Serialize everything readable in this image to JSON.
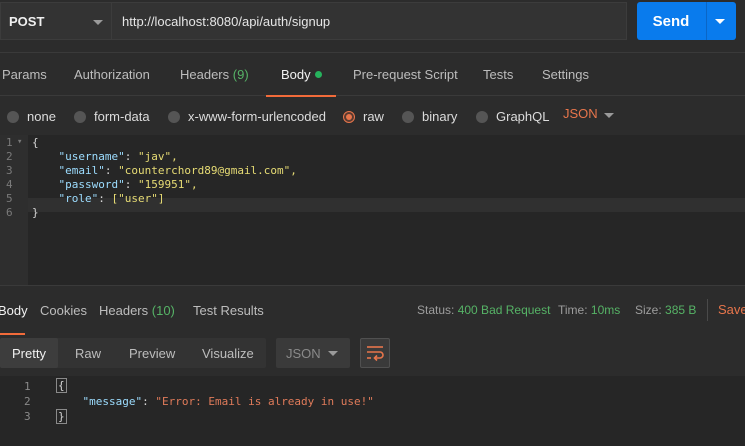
{
  "request": {
    "method": "POST",
    "url": "http://localhost:8080/api/auth/signup",
    "send_label": "Send"
  },
  "request_tabs": {
    "params": "Params",
    "authorization": "Authorization",
    "headers": "Headers",
    "headers_count": "(9)",
    "body": "Body",
    "pre_request_script": "Pre-request Script",
    "tests": "Tests",
    "settings": "Settings"
  },
  "body_modes": {
    "none": "none",
    "form_data": "form-data",
    "x_www_form_urlencoded": "x-www-form-urlencoded",
    "raw": "raw",
    "binary": "binary",
    "graphql": "GraphQL",
    "format": "JSON",
    "selected": "raw"
  },
  "request_body": {
    "line_numbers": [
      "1",
      "2",
      "3",
      "4",
      "5",
      "6"
    ],
    "open_brace": "{",
    "close_brace": "}",
    "fields": [
      {
        "key": "\"username\"",
        "value": "\"jav\","
      },
      {
        "key": "\"email\"",
        "value": "\"counterchord89@gmail.com\","
      },
      {
        "key": "\"password\"",
        "value": "\"159951\","
      },
      {
        "key": "\"role\"",
        "value": "[\"user\"]"
      }
    ]
  },
  "response_tabs": {
    "body": "Body",
    "cookies": "Cookies",
    "headers": "Headers",
    "headers_count": "(10)",
    "test_results": "Test Results"
  },
  "response_status": {
    "status_label": "Status:",
    "status_value": "400 Bad Request",
    "time_label": "Time:",
    "time_value": "10ms",
    "size_label": "Size:",
    "size_value": "385 B",
    "save_label": "Save"
  },
  "response_view": {
    "pretty": "Pretty",
    "raw": "Raw",
    "preview": "Preview",
    "visualize": "Visualize",
    "format": "JSON"
  },
  "response_body": {
    "line_numbers": [
      "1",
      "2",
      "3"
    ],
    "open_brace": "{",
    "close_brace": "}",
    "key": "\"message\"",
    "value": "\"Error: Email is already in use!\""
  },
  "colors": {
    "accent": "#f26b3a",
    "send": "#097bed",
    "success_count": "#56b366"
  },
  "icons": {
    "method_dropdown": "chevron-down-icon",
    "send_dropdown": "chevron-down-icon",
    "body_indicator": "green-dot-icon",
    "wrap": "wrap-lines-icon"
  }
}
